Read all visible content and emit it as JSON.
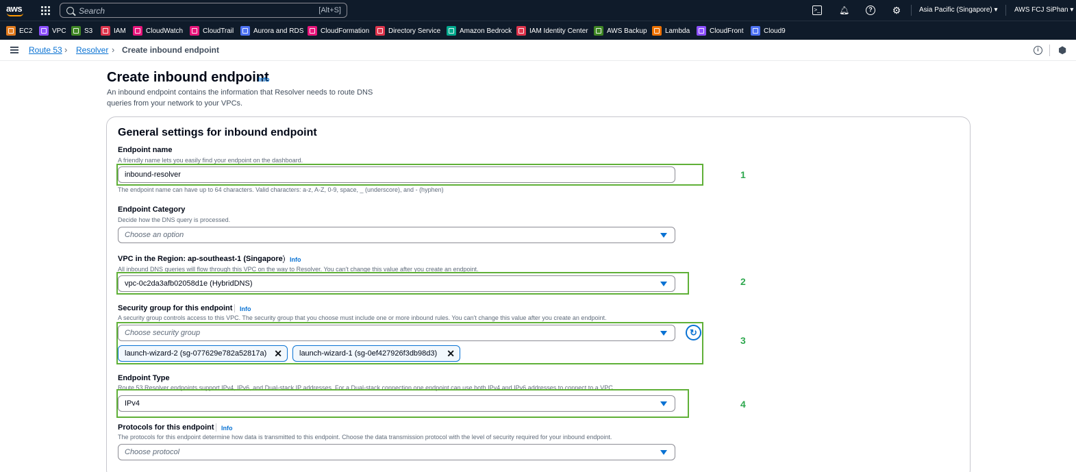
{
  "topnav": {
    "logo_text": "aws",
    "search_placeholder": "Search",
    "search_shortcut": "[Alt+S]",
    "region": "Asia Pacific (Singapore) ▾",
    "account": "AWS FCJ SiPhan ▾"
  },
  "favorites": [
    {
      "label": "EC2",
      "color": "#e07b1f"
    },
    {
      "label": "VPC",
      "color": "#8c4fff"
    },
    {
      "label": "S3",
      "color": "#3f8624"
    },
    {
      "label": "IAM",
      "color": "#dd344c"
    },
    {
      "label": "CloudWatch",
      "color": "#e7157b"
    },
    {
      "label": "CloudTrail",
      "color": "#e7157b"
    },
    {
      "label": "Aurora and RDS",
      "color": "#4d72f3"
    },
    {
      "label": "CloudFormation",
      "color": "#e7157b"
    },
    {
      "label": "Directory Service",
      "color": "#dd344c"
    },
    {
      "label": "Amazon Bedrock",
      "color": "#01a88d"
    },
    {
      "label": "IAM Identity Center",
      "color": "#dd344c"
    },
    {
      "label": "AWS Backup",
      "color": "#3f8624"
    },
    {
      "label": "Lambda",
      "color": "#ed7100"
    },
    {
      "label": "CloudFront",
      "color": "#8c4fff"
    },
    {
      "label": "Cloud9",
      "color": "#4d72f3"
    }
  ],
  "breadcrumb": {
    "items": [
      "Route 53",
      "Resolver"
    ],
    "current": "Create inbound endpoint"
  },
  "header": {
    "title": "Create inbound endpoint",
    "info": "Info",
    "description": "An inbound endpoint contains the information that Resolver needs to route DNS queries from your network to your VPCs."
  },
  "panel": {
    "title": "General settings for inbound endpoint"
  },
  "fields": {
    "endpoint_name": {
      "label": "Endpoint name",
      "description": "A friendly name lets you easily find your endpoint on the dashboard.",
      "value": "inbound-resolver",
      "constraint": "The endpoint name can have up to 64 characters. Valid characters: a-z, A-Z, 0-9, space, _ (underscore), and - (hyphen)"
    },
    "endpoint_category": {
      "label": "Endpoint Category",
      "description": "Decide how the DNS query is processed.",
      "placeholder": "Choose an option"
    },
    "vpc": {
      "label": "VPC in the Region: ap-southeast-1 (Singapore)",
      "info": "Info",
      "description": "All inbound DNS queries will flow through this VPC on the way to Resolver. You can't change this value after you create an endpoint.",
      "value": "vpc-0c2da3afb02058d1e (HybridDNS)"
    },
    "security_group": {
      "label": "Security group for this endpoint",
      "info": "Info",
      "description": "A security group controls access to this VPC. The security group that you choose must include one or more inbound rules. You can't change this value after you create an endpoint.",
      "placeholder": "Choose security group",
      "tokens": [
        "launch-wizard-2 (sg-077629e782a52817a)",
        "launch-wizard-1 (sg-0ef427926f3db98d3)"
      ]
    },
    "endpoint_type": {
      "label": "Endpoint Type",
      "description": "Route 53 Resolver endpoints support IPv4, IPv6, and Dual-stack IP addresses. For a Dual-stack connection one endpoint can use both IPv4 and IPv6 addresses to connect to a VPC.",
      "value": "IPv4"
    },
    "protocols": {
      "label": "Protocols for this endpoint",
      "info": "Info",
      "description": "The protocols for this endpoint determine how data is transmitted to this endpoint. Choose the data transmission protocol with the level of security required for your inbound endpoint.",
      "placeholder": "Choose protocol"
    }
  },
  "annotations": [
    "1",
    "2",
    "3",
    "4"
  ],
  "colors": {
    "nav_bg": "#0f1b2a",
    "link": "#0972d3",
    "highlight": "#5fb037",
    "annotation_number": "#2fa84f"
  }
}
